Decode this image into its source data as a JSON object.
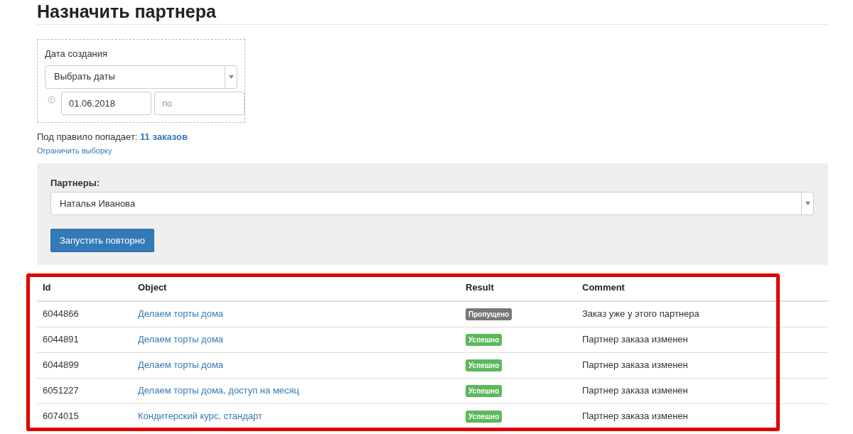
{
  "title": "Назначить партнера",
  "filter": {
    "label": "Дата создания",
    "select": "Выбрать даты",
    "date_from": "01.06.2018",
    "date_to_placeholder": "по"
  },
  "summary": {
    "text": "Под правило попадает:",
    "count": "11 заказов",
    "limit_link": "Ограничить выборку"
  },
  "partners": {
    "label": "Партнеры:",
    "select": "Наталья Иванова",
    "button": "Запустить повторно"
  },
  "table": {
    "columns": [
      "Id",
      "Object",
      "Result",
      "Comment"
    ],
    "rows": [
      {
        "id": "6044866",
        "object": "Делаем торты дома",
        "result": "Пропущено",
        "kind": "skipped",
        "comment": "Заказ уже у этого партнера"
      },
      {
        "id": "6044891",
        "object": "Делаем торты дома",
        "result": "Успешно",
        "kind": "success",
        "comment": "Партнер заказа изменен"
      },
      {
        "id": "6044899",
        "object": "Делаем торты дома",
        "result": "Успешно",
        "kind": "success",
        "comment": "Партнер заказа изменен"
      },
      {
        "id": "6051227",
        "object": "Делаем торты дома, доступ на месяц",
        "result": "Успешно",
        "kind": "success",
        "comment": "Партнер заказа изменен"
      },
      {
        "id": "6074015",
        "object": "Кондитерский курс, стандарт",
        "result": "Успешно",
        "kind": "success",
        "comment": "Партнер заказа изменен"
      }
    ]
  },
  "highlight": {
    "color": "#e00000"
  }
}
